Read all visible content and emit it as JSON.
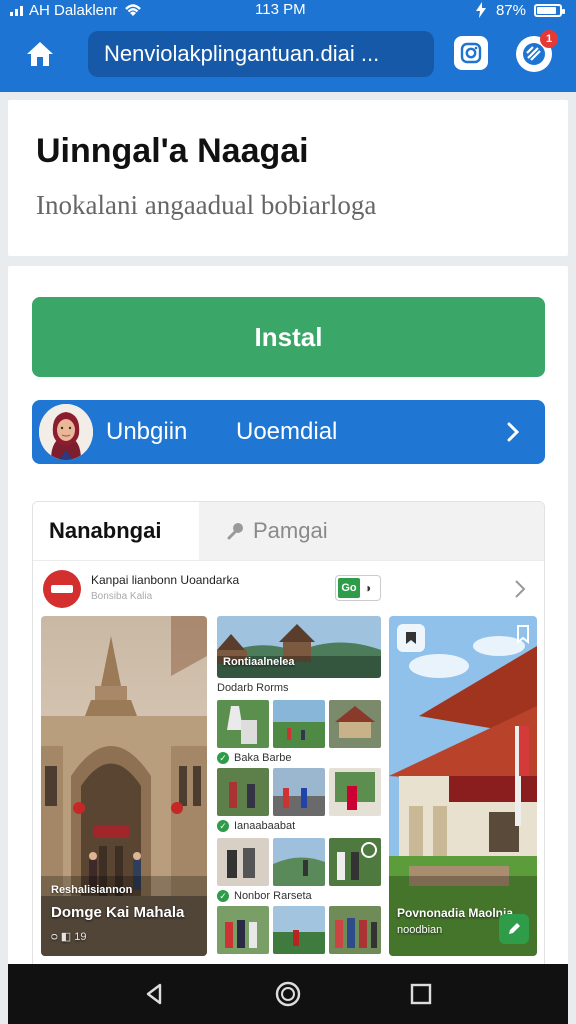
{
  "status_bar": {
    "carrier": "AH Dalaklenr",
    "time": "113 PM",
    "battery": "87%",
    "battery_level": 0.87
  },
  "browser": {
    "url": "Nenviolakplingantuan.diai ...",
    "extension_badge": "1",
    "icons": [
      "home-icon",
      "camera-icon",
      "extension-icon"
    ]
  },
  "header": {
    "title": "Uinngal'a Naagai",
    "subtitle": "Inokalani angaadual bobiarloga"
  },
  "actions": {
    "install_label": "Instal",
    "login_label_left": "Unbgiin",
    "login_label_right": "Uoemdial"
  },
  "tabs": [
    {
      "label": "Nanabngai",
      "active": true
    },
    {
      "label": "Pamgai",
      "active": false,
      "icon": "pin-icon"
    }
  ],
  "page": {
    "name": "Kanpai lianbonn Uoandarka",
    "meta": "Bonsiba Kalia",
    "tag_label": "Go"
  },
  "gallery": {
    "left": {
      "line1": "Reshalisiannon",
      "line2": "Domge Kai Mahala",
      "line3": "ᴑ ◧ 19"
    },
    "middle": {
      "header_caption": "Rontiaalnelea",
      "sections": [
        "Dodarb Rorms",
        "Baka Barbe",
        "Ianaabaabat",
        "Nonbor Rarseta"
      ]
    },
    "right": {
      "line1": "Povnonadia Maolnia",
      "line2": "noodbian"
    }
  },
  "colors": {
    "browser_bar": "#1e74d2",
    "install": "#3aa668",
    "login": "#1f76d3",
    "badge": "#e53935"
  }
}
